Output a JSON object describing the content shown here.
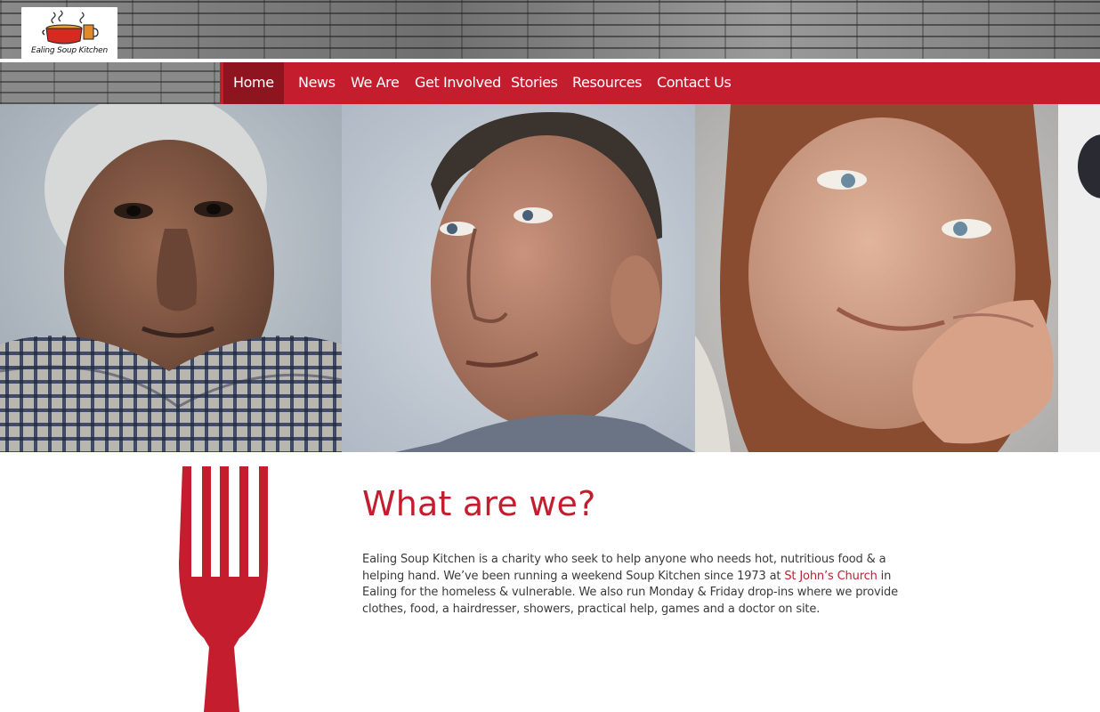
{
  "brand": {
    "logo_text": "Ealing Soup Kitchen",
    "accent_color": "#c41e2e",
    "nav_active_color": "#8e1520"
  },
  "nav": {
    "items": [
      {
        "label": "Home",
        "active": true
      },
      {
        "label": "News"
      },
      {
        "label": "We Are"
      },
      {
        "label": "Get Involved"
      },
      {
        "label": "Stories"
      },
      {
        "label": "Resources"
      },
      {
        "label": "Contact Us"
      }
    ]
  },
  "hero": {
    "photos": [
      "portrait-elderly-woman",
      "portrait-man",
      "portrait-smiling-woman"
    ]
  },
  "intro": {
    "title": "What are we?",
    "body_part1": "Ealing Soup Kitchen is a charity who seek to help anyone who needs hot, nutritious food & a helping hand. We’ve been running a weekend Soup Kitchen since 1973 at ",
    "link_text": "St John’s Church",
    "body_part2": " in Ealing for the homeless & vulnerable. We also run Monday & Friday drop-ins where we provide clothes, food, a hairdresser, showers, practical help, games and a doctor on site."
  },
  "icons": {
    "logo": "soup-pot-icon",
    "decoration": "fork-icon"
  }
}
